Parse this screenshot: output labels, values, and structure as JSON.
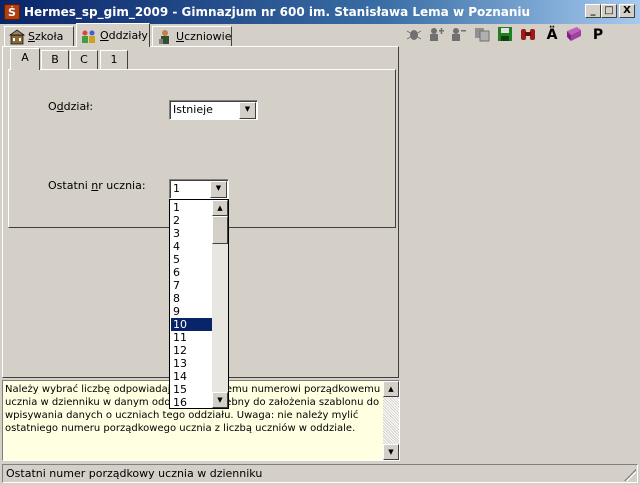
{
  "window": {
    "title": "Hermes_sp_gim_2009 - Gimnazjum nr 600 im. Stanisława Lema w Poznaniu",
    "app_icon_glyph": "Ś",
    "minimize": "_",
    "maximize": "□",
    "close": "X"
  },
  "tabs": [
    {
      "prefix": "",
      "underline": "S",
      "suffix": "zkoła",
      "icon": "school-icon"
    },
    {
      "prefix": "",
      "underline": "O",
      "suffix": "ddziały",
      "icon": "class-icon"
    },
    {
      "prefix": "",
      "underline": "U",
      "suffix": "czniowie",
      "icon": "student-icon"
    }
  ],
  "toolbar": {
    "icons": [
      "bug-icon",
      "add-person-icon",
      "remove-person-icon",
      "copy-icon",
      "save-icon",
      "binoculars-icon",
      "font-icon",
      "book-icon",
      "print-icon"
    ],
    "font_label": "Ä",
    "print_label": "P"
  },
  "subtabs": [
    "A",
    "B",
    "C",
    "1"
  ],
  "form": {
    "oddzial_label_pre": "O",
    "oddzial_label_ul": "d",
    "oddzial_label_post": "dział:",
    "oddzial_value": "Istnieje",
    "last_nr_label_pre": "Ostatni ",
    "last_nr_label_ul": "n",
    "last_nr_label_post": "r ucznia:",
    "last_nr_value": "1"
  },
  "dropdown": {
    "options": [
      "1",
      "2",
      "3",
      "4",
      "5",
      "6",
      "7",
      "8",
      "9",
      "10",
      "11",
      "12",
      "13",
      "14",
      "15",
      "16"
    ],
    "selected": "10"
  },
  "help": {
    "text": "Należy wybrać liczbę odpowiadającą ostatniemu numerowi porządkowemu ucznia w dzienniku w danym oddziale. Potrzebny do założenia szablonu do wpisywania danych o uczniach tego oddziału. Uwaga: nie należy mylić ostatniego numeru porządkowego ucznia z liczbą uczniów w oddziale."
  },
  "status": {
    "text": "Ostatni numer porządkowy ucznia w dzienniku"
  },
  "colors": {
    "face": "#d4d0c8",
    "title_dark": "#0a246a",
    "title_light": "#a6caf0",
    "selection": "#0a246a",
    "help_bg": "#ffffe1"
  }
}
